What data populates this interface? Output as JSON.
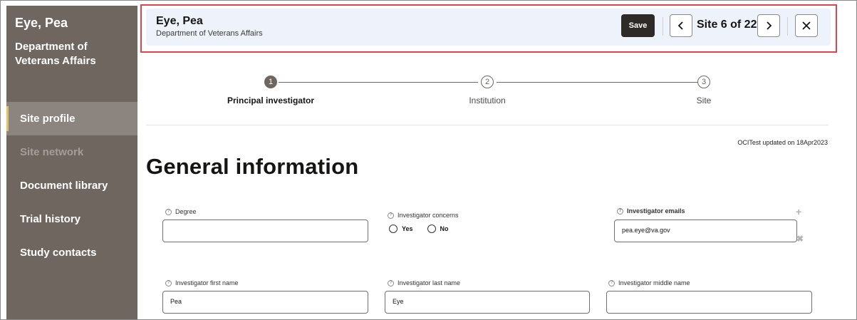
{
  "sidebar": {
    "title": "Eye, Pea",
    "org": "Department of Veterans Affairs",
    "items": [
      {
        "label": "Site profile"
      },
      {
        "label": "Site network"
      },
      {
        "label": "Document library"
      },
      {
        "label": "Trial history"
      },
      {
        "label": "Study contacts"
      }
    ]
  },
  "header": {
    "name": "Eye, Pea",
    "org": "Department of Veterans Affairs",
    "save_label": "Save",
    "counter": "Site 6 of 22"
  },
  "stepper": {
    "steps": [
      {
        "num": "1",
        "label": "Principal investigator"
      },
      {
        "num": "2",
        "label": "Institution"
      },
      {
        "num": "3",
        "label": "Site"
      }
    ]
  },
  "updated_text": "OCITest updated on 18Apr2023",
  "page_title": "General information",
  "form": {
    "degree": {
      "label": "Degree",
      "value": ""
    },
    "concerns": {
      "label": "Investigator concerns",
      "yes": "Yes",
      "no": "No"
    },
    "emails": {
      "label": "Investigator emails",
      "value": "pea.eye@va.gov"
    },
    "first_name": {
      "label": "Investigator first name",
      "value": "Pea"
    },
    "last_name": {
      "label": "Investigator last name",
      "value": "Eye"
    },
    "middle_name": {
      "label": "Investigator middle name",
      "value": ""
    }
  }
}
